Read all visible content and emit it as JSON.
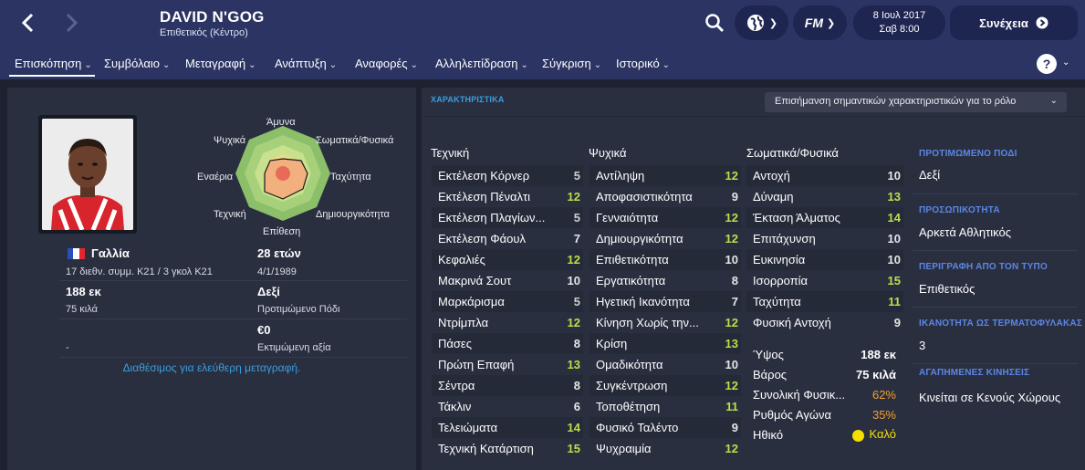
{
  "header": {
    "player_name": "DAVID N'GOG",
    "position": "Επιθετικός (Κέντρο)",
    "date": "8 Ιουλ 2017",
    "time": "Σαβ 8:00",
    "continue_label": "Συνέχεια",
    "fm_label": "FM"
  },
  "menu": {
    "items": [
      {
        "label": "Επισκόπηση"
      },
      {
        "label": "Συμβόλαιο"
      },
      {
        "label": "Μεταγραφή"
      },
      {
        "label": "Ανάπτυξη"
      },
      {
        "label": "Αναφορές"
      },
      {
        "label": "Αλληλεπίδραση"
      },
      {
        "label": "Σύγκριση"
      },
      {
        "label": "Ιστορικό"
      }
    ],
    "help_label": "?"
  },
  "profile": {
    "nation": "Γαλλία",
    "international": "17 διεθν. συμμ. K21 / 3 γκολ K21",
    "age": "28 ετών",
    "dob": "4/1/1989",
    "height": "188 εκ",
    "weight": "75 κιλά",
    "foot": "Δεξί",
    "foot_label": "Προτιμώμενο Πόδι",
    "value": "€0",
    "value_label": "Εκτιμώμενη αξία",
    "dash": "-",
    "transfer_status": "Διαθέσιμος για ελεύθερη μεταγραφή."
  },
  "radar": {
    "labels": {
      "top": "Άμυνα",
      "top_right": "Σωματικά/Φυσικά",
      "right": "Ταχύτητα",
      "bottom_right": "Δημιουργικότητα",
      "bottom": "Επίθεση",
      "bottom_left": "Τεχνική",
      "left": "Εναέρια",
      "top_left": "Ψυχικά"
    }
  },
  "attributes": {
    "title": "ΧΑΡΑΚΤΗΡΙΣΤΙΚΑ",
    "highlight_select": "Επισήμανση σημαντικών χαρακτηριστικών για το ρόλο",
    "technical_title": "Τεχνική",
    "mental_title": "Ψυχικά",
    "physical_title": "Σωματικά/Φυσικά",
    "technical": [
      {
        "name": "Εκτέλεση Κόρνερ",
        "value": "5"
      },
      {
        "name": "Εκτέλεση Πέναλτι",
        "value": "12"
      },
      {
        "name": "Εκτέλεση Πλαγίων...",
        "value": "5"
      },
      {
        "name": "Εκτέλεση Φάουλ",
        "value": "7"
      },
      {
        "name": "Κεφαλιές",
        "value": "12"
      },
      {
        "name": "Μακρινά Σουτ",
        "value": "10"
      },
      {
        "name": "Μαρκάρισμα",
        "value": "5"
      },
      {
        "name": "Ντρίμπλα",
        "value": "12"
      },
      {
        "name": "Πάσες",
        "value": "8"
      },
      {
        "name": "Πρώτη Επαφή",
        "value": "13"
      },
      {
        "name": "Σέντρα",
        "value": "8"
      },
      {
        "name": "Τάκλιν",
        "value": "6"
      },
      {
        "name": "Τελειώματα",
        "value": "14"
      },
      {
        "name": "Τεχνική Κατάρτιση",
        "value": "15"
      }
    ],
    "mental": [
      {
        "name": "Αντίληψη",
        "value": "12"
      },
      {
        "name": "Αποφασιστικότητα",
        "value": "9"
      },
      {
        "name": "Γενναιότητα",
        "value": "12"
      },
      {
        "name": "Δημιουργικότητα",
        "value": "12"
      },
      {
        "name": "Επιθετικότητα",
        "value": "10"
      },
      {
        "name": "Εργατικότητα",
        "value": "8"
      },
      {
        "name": "Ηγετική Ικανότητα",
        "value": "7"
      },
      {
        "name": "Κίνηση Χωρίς την...",
        "value": "12"
      },
      {
        "name": "Κρίση",
        "value": "13"
      },
      {
        "name": "Ομαδικότητα",
        "value": "10"
      },
      {
        "name": "Συγκέντρωση",
        "value": "12"
      },
      {
        "name": "Τοποθέτηση",
        "value": "11"
      },
      {
        "name": "Φυσικό Ταλέντο",
        "value": "9"
      },
      {
        "name": "Ψυχραιμία",
        "value": "12"
      }
    ],
    "physical": [
      {
        "name": "Αντοχή",
        "value": "10"
      },
      {
        "name": "Δύναμη",
        "value": "13"
      },
      {
        "name": "Έκταση Άλματος",
        "value": "14"
      },
      {
        "name": "Επιτάχυνση",
        "value": "10"
      },
      {
        "name": "Ευκινησία",
        "value": "10"
      },
      {
        "name": "Ισορροπία",
        "value": "15"
      },
      {
        "name": "Ταχύτητα",
        "value": "11"
      },
      {
        "name": "Φυσική Αντοχή",
        "value": "9"
      }
    ],
    "extras": [
      {
        "name": "Ύψος",
        "value": "188 εκ"
      },
      {
        "name": "Βάρος",
        "value": "75 κιλά"
      },
      {
        "name": "Συνολική Φυσικ...",
        "value": "62%"
      },
      {
        "name": "Ρυθμός Αγώνα",
        "value": "35%"
      },
      {
        "name": "Ηθικό",
        "value": "Καλό"
      }
    ]
  },
  "sidebar": {
    "items": [
      {
        "heading": "ΠΡΟΤΙΜΩΜΕΝΟ ΠΟΔΙ",
        "value": "Δεξί"
      },
      {
        "heading": "ΠΡΟΣΩΠΙΚΟΤΗΤΑ",
        "value": "Αρκετά Αθλητικός"
      },
      {
        "heading": "ΠΕΡΙΓΡΑΦΗ ΑΠΟ ΤΟΝ ΤΥΠΟ",
        "value": "Επιθετικός"
      },
      {
        "heading": "ΙΚΑΝΟΤΗΤΑ ΩΣ ΤΕΡΜΑΤΟΦΥΛΑΚΑΣ",
        "value": "3"
      },
      {
        "heading": "ΑΓΑΠΗΜΕΝΕΣ ΚΙΝΗΣΕΙΣ",
        "value": "Κινείται σε Κενούς Χώρους"
      }
    ]
  },
  "colors": {
    "topbar": "#2b3463",
    "panel": "#2a2f40",
    "value_white": "#e6e6e6",
    "value_green": "#b8e04a",
    "value_light": "#cfcfcf",
    "orange": "#f0a030",
    "accent_blue": "#3a9de0"
  }
}
